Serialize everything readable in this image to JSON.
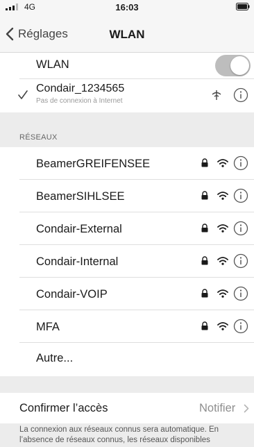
{
  "status_bar": {
    "carrier": "4G",
    "time": "16:03"
  },
  "nav": {
    "back_label": "Réglages",
    "title": "WLAN"
  },
  "wlan": {
    "label": "WLAN",
    "enabled": true
  },
  "connected": {
    "name": "Condair_1234565",
    "status": "Pas de connexion à Internet"
  },
  "networks": {
    "header": "RÉSEAUX",
    "items": [
      {
        "name": "BeamerGREIFENSEE",
        "secured": true
      },
      {
        "name": "BeamerSIHLSEE",
        "secured": true
      },
      {
        "name": "Condair-External",
        "secured": true
      },
      {
        "name": "Condair-Internal",
        "secured": true
      },
      {
        "name": "Condair-VOIP",
        "secured": true
      },
      {
        "name": "MFA",
        "secured": true
      }
    ],
    "other_label": "Autre..."
  },
  "confirm_access": {
    "label": "Confirmer l’accès",
    "value": "Notifier"
  },
  "footer_text": "La connexion aux réseaux connus sera automatique. En l’absence de réseaux connus, les réseaux disponibles",
  "colors": {
    "accent": "#444444",
    "toggle": "#bdbdbd",
    "background": "#ececec"
  },
  "icons": [
    "signal-icon",
    "battery-icon",
    "back-chevron-icon",
    "checkmark-icon",
    "no-internet-icon",
    "lock-icon",
    "wifi-icon",
    "info-icon",
    "chevron-right-icon"
  ]
}
